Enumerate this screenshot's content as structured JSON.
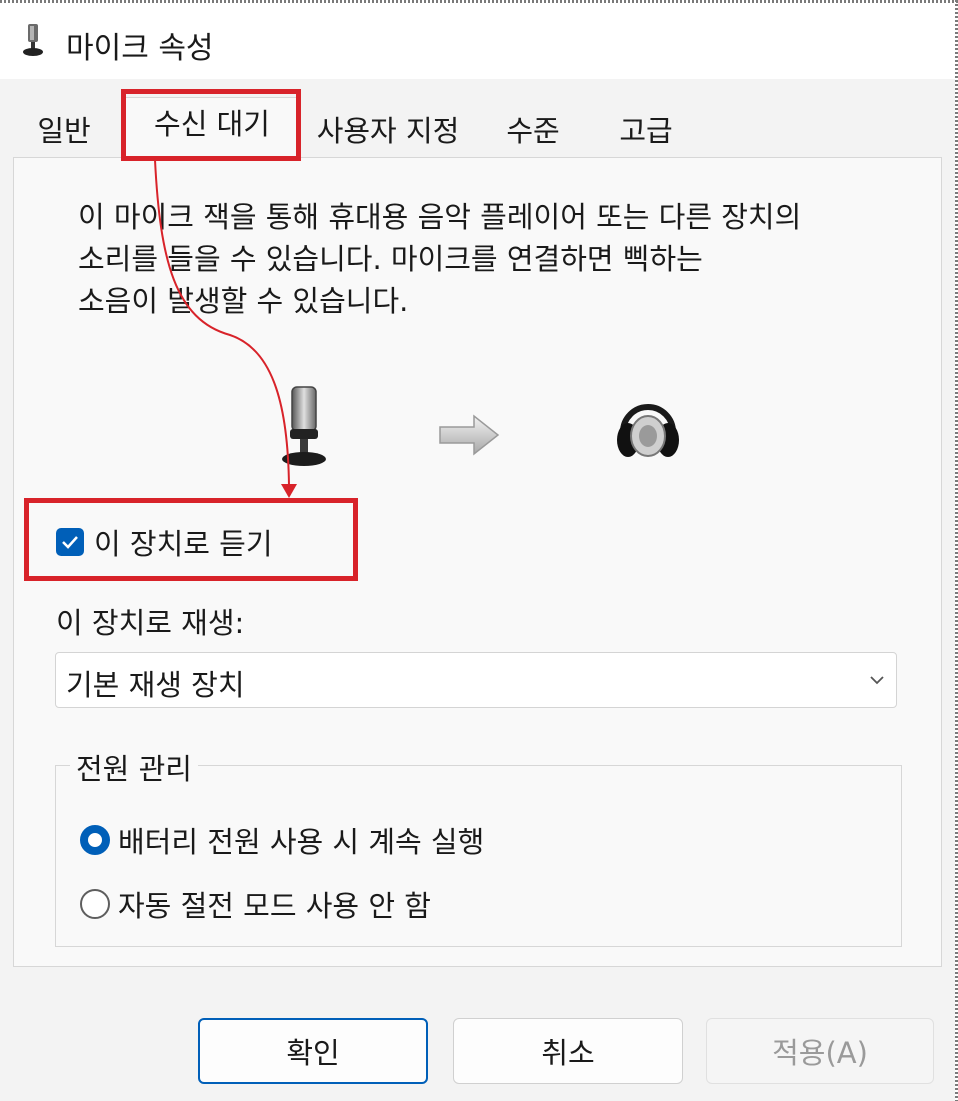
{
  "window": {
    "title": "마이크 속성"
  },
  "tabs": [
    {
      "label": "일반"
    },
    {
      "label": "수신 대기"
    },
    {
      "label": "사용자 지정"
    },
    {
      "label": "수준"
    },
    {
      "label": "고급"
    }
  ],
  "listen": {
    "description_lines": [
      "이 마이크 잭을 통해 휴대용 음악 플레이어 또는 다른 장치의",
      "소리를 들을 수 있습니다. 마이크를 연결하면 삑하는",
      "소음이 발생할 수 있습니다."
    ],
    "listen_checkbox_label": "이 장치로 듣기",
    "listen_checked": true,
    "playback_label": "이 장치로 재생:",
    "playback_selected": "기본 재생 장치"
  },
  "power": {
    "group_label": "전원 관리",
    "options": [
      {
        "label": "배터리 전원 사용 시 계속 실행",
        "selected": true
      },
      {
        "label": "자동 절전 모드 사용 안 함",
        "selected": false
      }
    ]
  },
  "buttons": {
    "ok": "확인",
    "cancel": "취소",
    "apply": "적용(A)"
  },
  "colors": {
    "accent": "#005fb8",
    "annotation": "#d8232a"
  }
}
